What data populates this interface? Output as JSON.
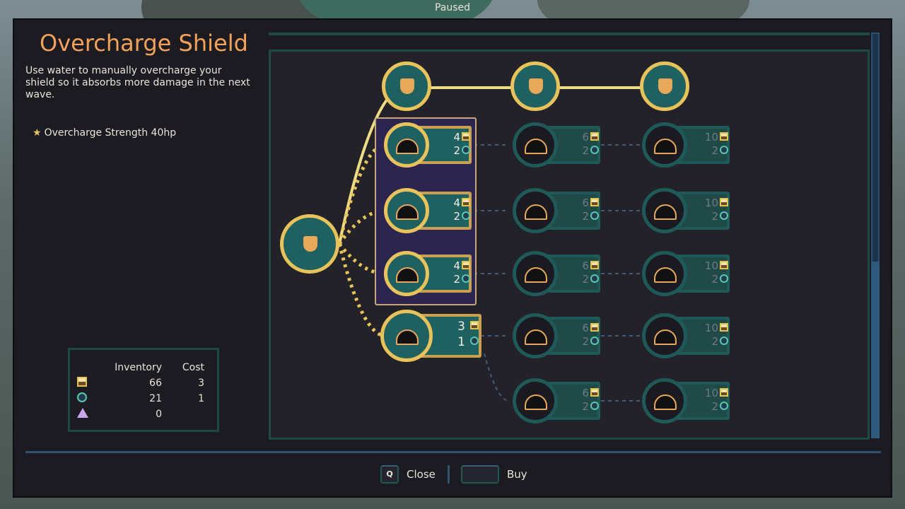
{
  "hud": {
    "status": "Paused"
  },
  "upgrade": {
    "title": "Overcharge Shield",
    "description": "Use water to manually overcharge your shield so it absorbs more damage in the next wave.",
    "stat": "Overcharge Strength 40hp"
  },
  "inventory": {
    "headers": [
      "Inventory",
      "Cost"
    ],
    "rows": [
      {
        "icon": "gold-icon",
        "inventory": "66",
        "cost": "3"
      },
      {
        "icon": "water-icon",
        "inventory": "21",
        "cost": "1"
      },
      {
        "icon": "crystal-icon",
        "inventory": "0",
        "cost": ""
      }
    ]
  },
  "footer": {
    "close_key": "Q",
    "close_label": "Close",
    "buy_label": "Buy"
  },
  "tree": {
    "top_row": [
      {
        "name": "shield-small",
        "owned": true
      },
      {
        "name": "shield-medium",
        "owned": true
      },
      {
        "name": "shield-large",
        "owned": true
      }
    ],
    "nodes": [
      {
        "name": "overcharge-burst",
        "col": 1,
        "row": 1,
        "gold": "4",
        "water": "2",
        "owned": true
      },
      {
        "name": "overcharge-halo",
        "col": 1,
        "row": 2,
        "gold": "4",
        "water": "2",
        "owned": true
      },
      {
        "name": "overcharge-spikes",
        "col": 1,
        "row": 3,
        "gold": "4",
        "water": "2",
        "owned": true
      },
      {
        "name": "overcharge-badge",
        "col": 1,
        "row": 4,
        "gold": "3",
        "water": "1",
        "owned": true,
        "selected": true
      },
      {
        "name": "lightning-dome",
        "col": 2,
        "row": 1,
        "gold": "6",
        "water": "2"
      },
      {
        "name": "halo-arrow",
        "col": 2,
        "row": 2,
        "gold": "6",
        "water": "2"
      },
      {
        "name": "double-spikes",
        "col": 2,
        "row": 3,
        "gold": "6",
        "water": "2"
      },
      {
        "name": "fist-moon",
        "col": 2,
        "row": 4,
        "gold": "6",
        "water": "2"
      },
      {
        "name": "rotating-badge",
        "col": 2,
        "row": 5,
        "gold": "6",
        "water": "2"
      },
      {
        "name": "lightning-figure",
        "col": 3,
        "row": 1,
        "gold": "10",
        "water": "2"
      },
      {
        "name": "halo-shield",
        "col": 3,
        "row": 2,
        "gold": "10",
        "water": "2"
      },
      {
        "name": "sword-arc",
        "col": 3,
        "row": 3,
        "gold": "10",
        "water": "2"
      },
      {
        "name": "fist-burst",
        "col": 3,
        "row": 4,
        "gold": "10",
        "water": "2"
      },
      {
        "name": "rotating-badge-burst",
        "col": 3,
        "row": 5,
        "gold": "10",
        "water": "2"
      }
    ]
  },
  "colors": {
    "accent": "#f4a25a",
    "gold": "#e8c25a",
    "teal": "#1f5a58",
    "panel": "#1c1b21"
  }
}
